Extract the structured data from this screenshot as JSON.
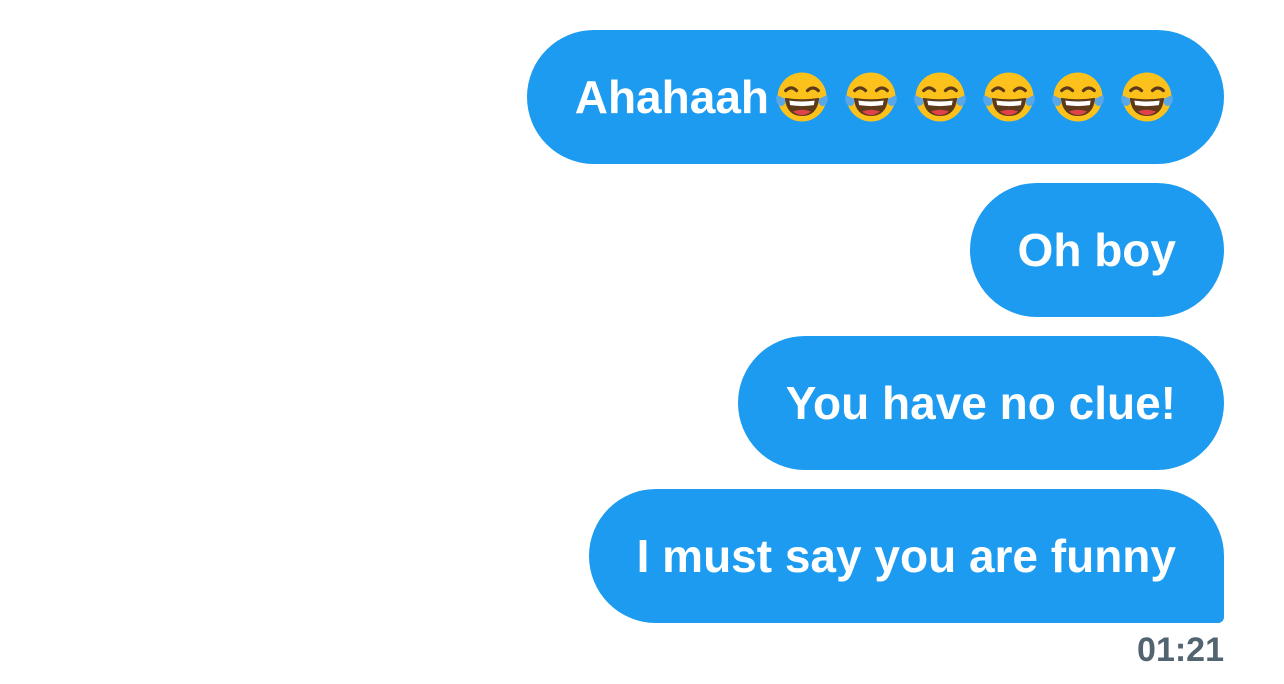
{
  "messages": [
    {
      "text": "Ahahaah",
      "emoji": [
        "face-with-tears-of-joy-icon",
        "face-with-tears-of-joy-icon",
        "face-with-tears-of-joy-icon",
        "face-with-tears-of-joy-icon",
        "face-with-tears-of-joy-icon",
        "face-with-tears-of-joy-icon"
      ]
    },
    {
      "text": "Oh boy"
    },
    {
      "text": "You have no clue!"
    },
    {
      "text": "I must say you are funny"
    }
  ],
  "timestamp": "01:21",
  "colors": {
    "bubble": "#1d9bf0",
    "bubble_text": "#ffffff",
    "timestamp": "#536471",
    "emoji_face": "#fcc21b",
    "emoji_tears": "#5aa7e8"
  }
}
